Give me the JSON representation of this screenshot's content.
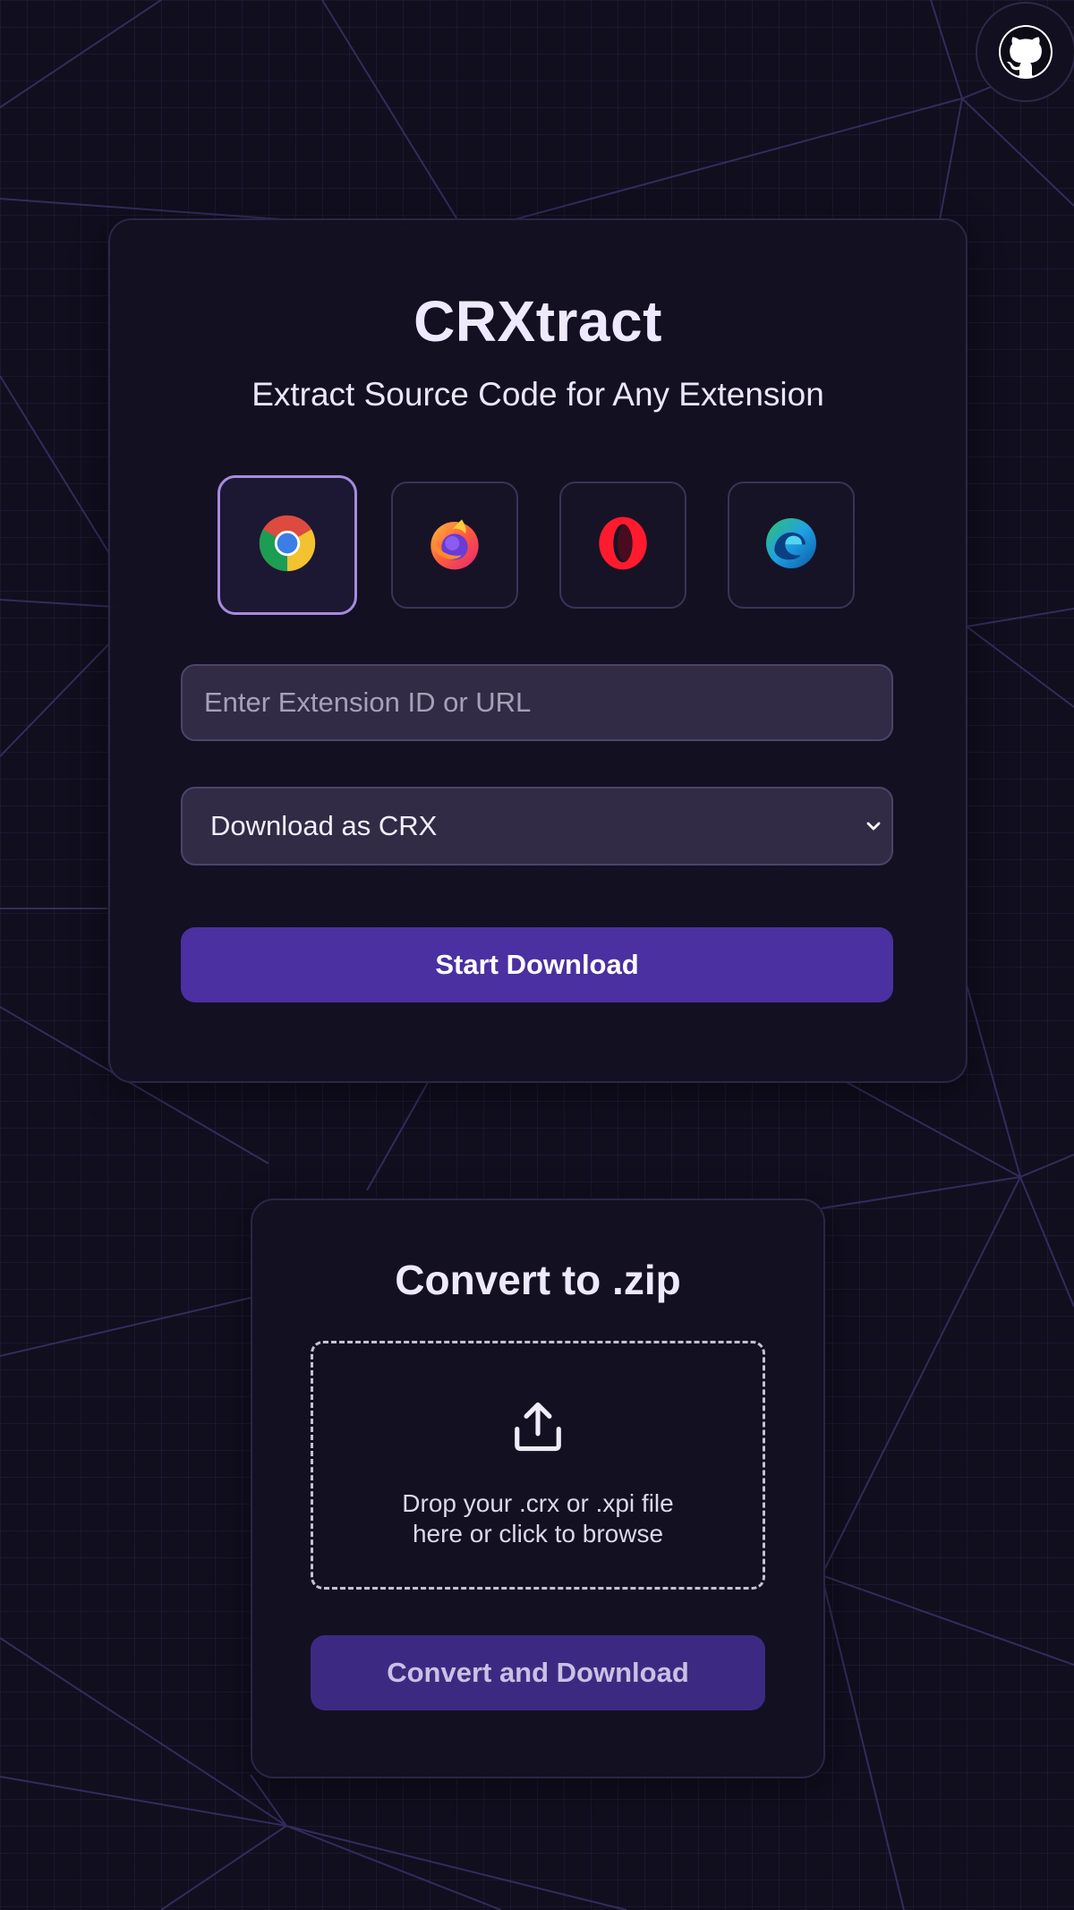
{
  "header": {
    "github_icon": "github-icon"
  },
  "main_card": {
    "title": "CRXtract",
    "subtitle": "Extract Source Code for Any Extension",
    "browsers": [
      {
        "name": "chrome",
        "icon": "chrome-icon",
        "selected": true
      },
      {
        "name": "firefox",
        "icon": "firefox-icon",
        "selected": false
      },
      {
        "name": "opera",
        "icon": "opera-icon",
        "selected": false
      },
      {
        "name": "edge",
        "icon": "edge-icon",
        "selected": false
      }
    ],
    "extension_input": {
      "placeholder": "Enter Extension ID or URL",
      "value": ""
    },
    "download_format": {
      "selected": "Download as CRX"
    },
    "start_button_label": "Start Download"
  },
  "convert_card": {
    "title": "Convert to .zip",
    "dropzone_text_line1": "Drop your .crx or .xpi file",
    "dropzone_text_line2": "here or click to browse",
    "convert_button_label": "Convert and Download"
  },
  "colors": {
    "background": "#110e1e",
    "card": "#141122",
    "accent": "#4a30a0",
    "accent_muted": "#3c2a82",
    "selected_border": "#a78bdf",
    "input_bg": "#312b45"
  }
}
